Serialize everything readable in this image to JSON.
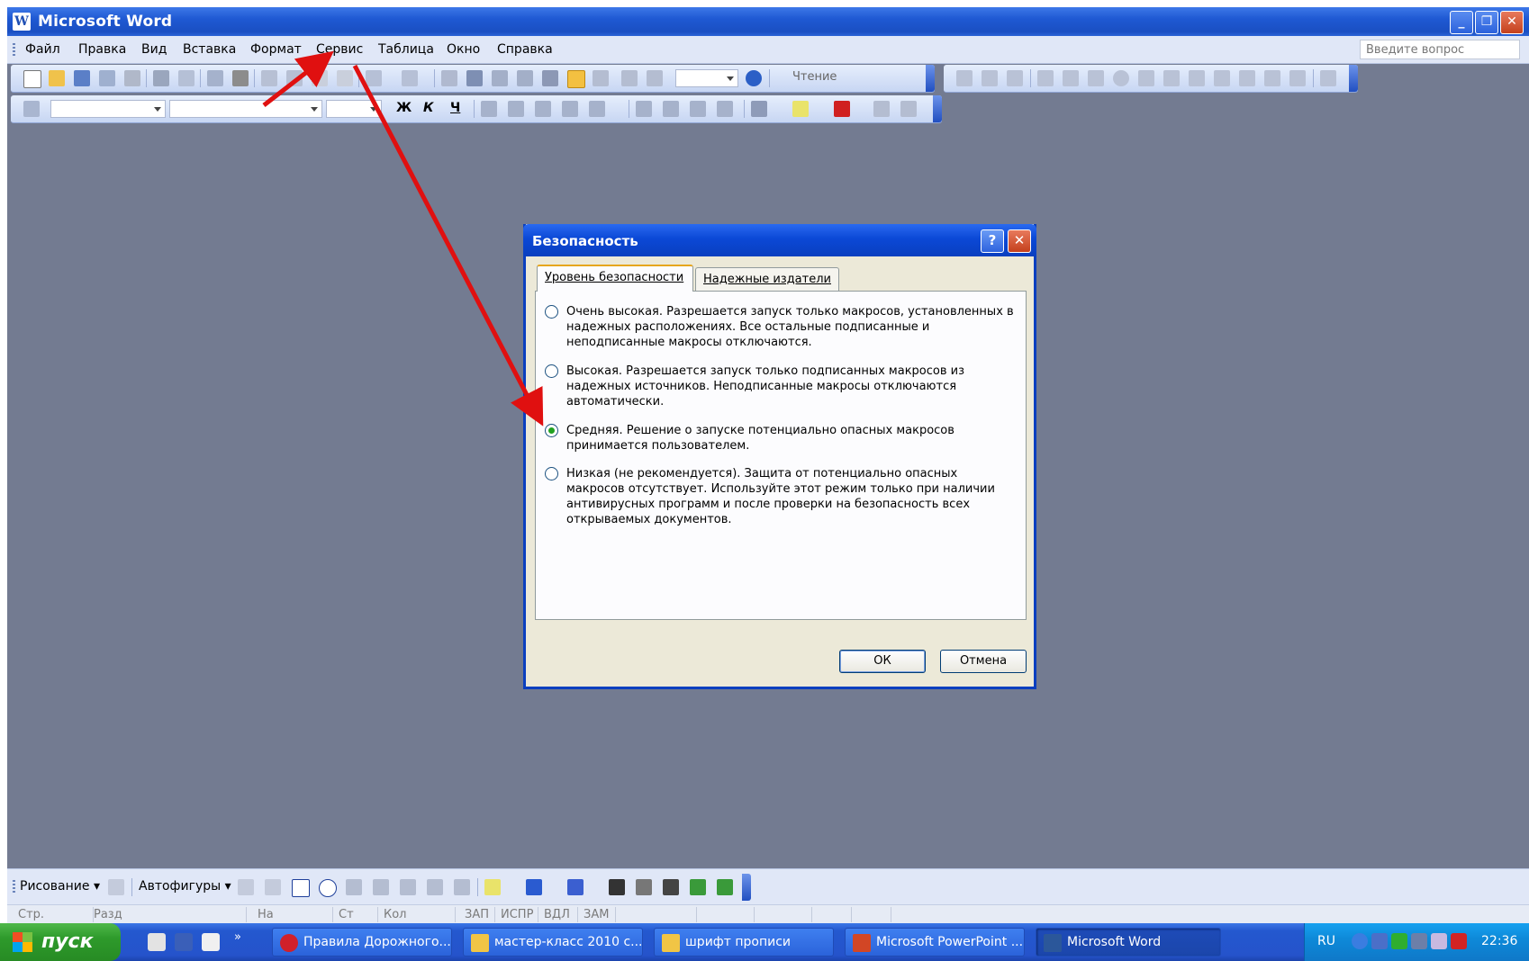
{
  "window": {
    "title": "Microsoft Word",
    "app_icon": "W",
    "minimize_icon": "minimize-icon",
    "restore_icon": "restore-icon",
    "close_icon": "close-icon"
  },
  "menubar": {
    "items": [
      "Файл",
      "Правка",
      "Вид",
      "Вставка",
      "Формат",
      "Сервис",
      "Таблица",
      "Окно",
      "Справка"
    ],
    "ask_placeholder": "Введите вопрос"
  },
  "toolbar": {
    "reading_label": "Чтение",
    "bold": "Ж",
    "italic": "К",
    "underline": "Ч",
    "zoom_value": ""
  },
  "dialog": {
    "title": "Безопасность",
    "help": "?",
    "close": "✕",
    "tabs": [
      "Уровень безопасности",
      "Надежные издатели"
    ],
    "active_tab": 0,
    "options": [
      {
        "text": "Очень высокая. Разрешается запуск только макросов, установленных в надежных расположениях. Все остальные подписанные и неподписанные макросы отключаются.",
        "checked": false
      },
      {
        "text": "Высокая. Разрешается запуск только подписанных макросов из надежных источников. Неподписанные макросы отключаются автоматически.",
        "checked": false
      },
      {
        "text": "Средняя. Решение о запуске потенциально опасных макросов принимается пользователем.",
        "checked": true
      },
      {
        "text": "Низкая (не рекомендуется). Защита от потенциально опасных макросов отсутствует. Используйте этот режим только при наличии антивирусных программ и после проверки на безопасность всех открываемых документов.",
        "checked": false
      }
    ],
    "ok": "ОК",
    "cancel": "Отмена"
  },
  "drawing_toolbar": {
    "drawing": "Рисование ▾",
    "autoshapes": "Автофигуры ▾"
  },
  "statusbar": {
    "cells": [
      "Стр.",
      "Разд",
      "На",
      "Ст",
      "Кол",
      "ЗАП",
      "ИСПР",
      "ВДЛ",
      "ЗАМ"
    ]
  },
  "taskbar": {
    "start": "пуск",
    "tasks": [
      {
        "label": "Правила Дорожного...",
        "icon": "opera-icon",
        "color": "#d0202a"
      },
      {
        "label": "мастер-класс 2010 с...",
        "icon": "folder-icon",
        "color": "#f1c545"
      },
      {
        "label": "шрифт прописи",
        "icon": "folder-icon",
        "color": "#f1c545"
      },
      {
        "label": "Microsoft PowerPoint ...",
        "icon": "powerpoint-icon",
        "color": "#d24625"
      },
      {
        "label": "Microsoft Word",
        "icon": "word-icon",
        "color": "#2b579a"
      }
    ],
    "active_task": 4,
    "lang": "RU",
    "clock": "22:36"
  },
  "colors": {
    "workspace": "#737b91",
    "annotation_arrow": "#e01010",
    "dialog_border": "#0a3fbf"
  }
}
